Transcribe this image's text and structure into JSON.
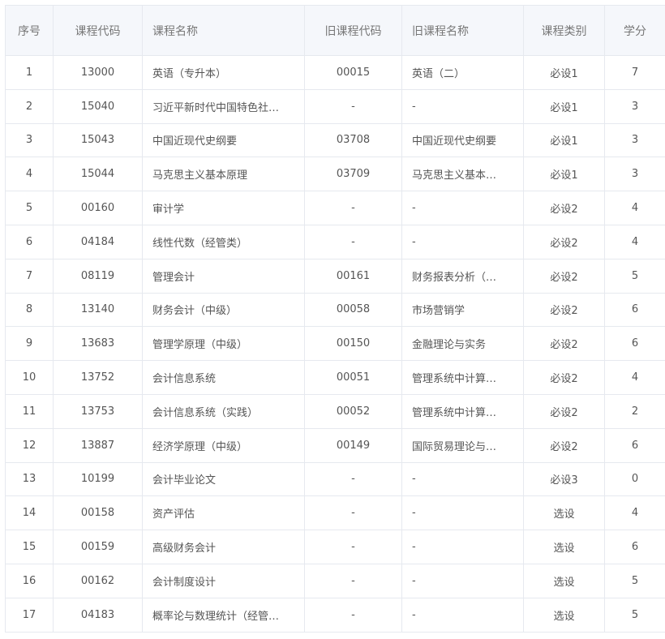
{
  "headers": [
    "序号",
    "课程代码",
    "课程名称",
    "旧课程代码",
    "旧课程名称",
    "课程类别",
    "学分"
  ],
  "rows": [
    [
      "1",
      "13000",
      "英语（专升本）",
      "00015",
      "英语（二）",
      "必设1",
      "7"
    ],
    [
      "2",
      "15040",
      "习近平新时代中国特色社…",
      "-",
      "-",
      "必设1",
      "3"
    ],
    [
      "3",
      "15043",
      "中国近现代史纲要",
      "03708",
      "中国近现代史纲要",
      "必设1",
      "3"
    ],
    [
      "4",
      "15044",
      "马克思主义基本原理",
      "03709",
      "马克思主义基本…",
      "必设1",
      "3"
    ],
    [
      "5",
      "00160",
      "审计学",
      "-",
      "-",
      "必设2",
      "4"
    ],
    [
      "6",
      "04184",
      "线性代数（经管类）",
      "-",
      "-",
      "必设2",
      "4"
    ],
    [
      "7",
      "08119",
      "管理会计",
      "00161",
      "财务报表分析（…",
      "必设2",
      "5"
    ],
    [
      "8",
      "13140",
      "财务会计（中级）",
      "00058",
      "市场营销学",
      "必设2",
      "6"
    ],
    [
      "9",
      "13683",
      "管理学原理（中级）",
      "00150",
      "金融理论与实务",
      "必设2",
      "6"
    ],
    [
      "10",
      "13752",
      "会计信息系统",
      "00051",
      "管理系统中计算…",
      "必设2",
      "4"
    ],
    [
      "11",
      "13753",
      "会计信息系统（实践）",
      "00052",
      "管理系统中计算…",
      "必设2",
      "2"
    ],
    [
      "12",
      "13887",
      "经济学原理（中级）",
      "00149",
      "国际贸易理论与…",
      "必设2",
      "6"
    ],
    [
      "13",
      "10199",
      "会计毕业论文",
      "-",
      "-",
      "必设3",
      "0"
    ],
    [
      "14",
      "00158",
      "资产评估",
      "-",
      "-",
      "选设",
      "4"
    ],
    [
      "15",
      "00159",
      "高级财务会计",
      "-",
      "-",
      "选设",
      "6"
    ],
    [
      "16",
      "00162",
      "会计制度设计",
      "-",
      "-",
      "选设",
      "5"
    ],
    [
      "17",
      "04183",
      "概率论与数理统计（经管…",
      "-",
      "-",
      "选设",
      "5"
    ]
  ]
}
